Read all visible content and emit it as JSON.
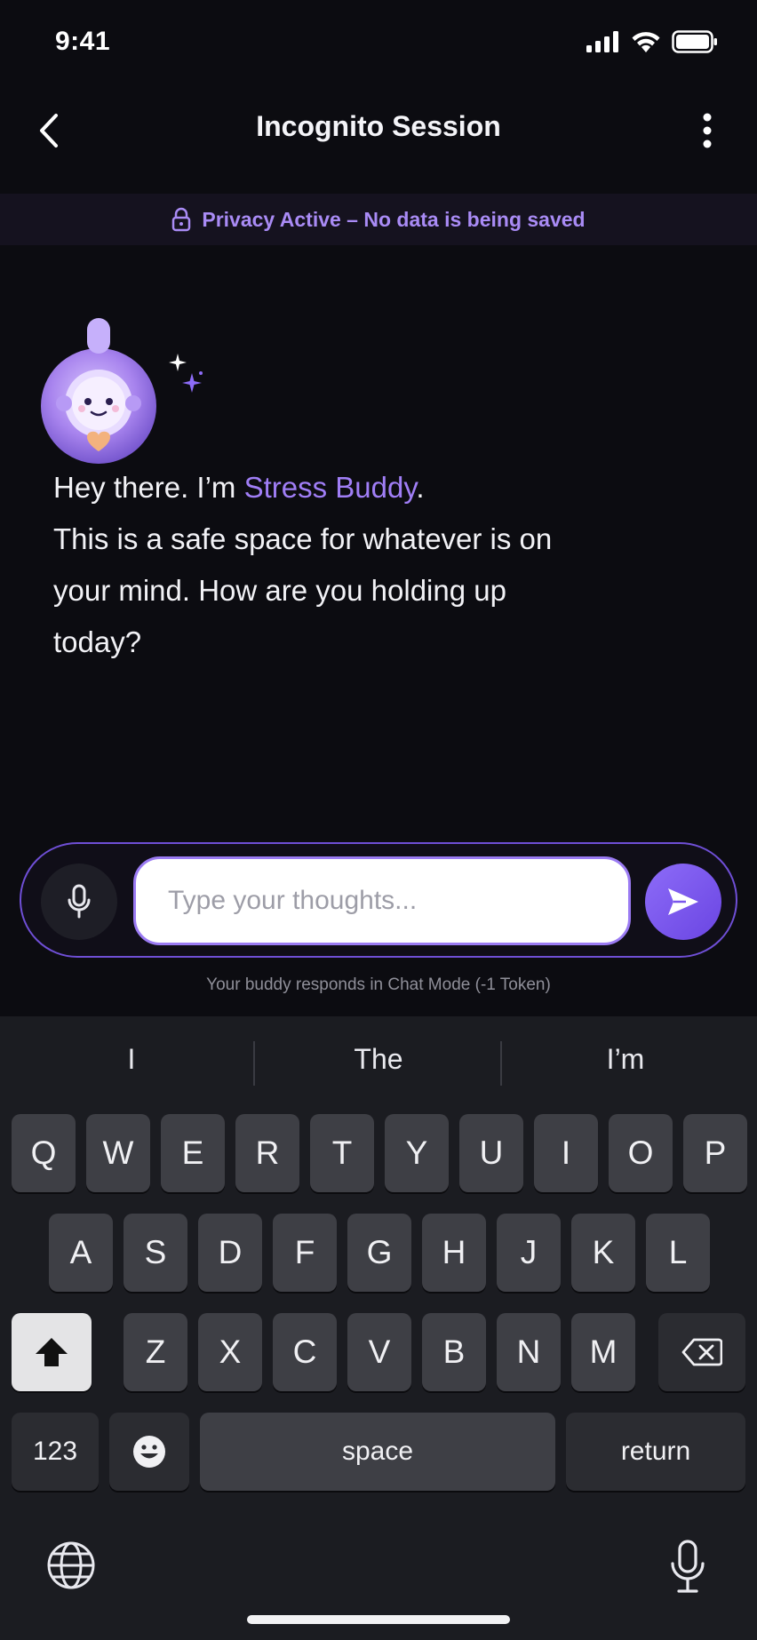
{
  "status_bar": {
    "time": "9:41"
  },
  "header": {
    "title": "Incognito Session"
  },
  "privacy_banner": {
    "text": "Privacy Active – No data is being saved"
  },
  "chat": {
    "greeting_prefix": "Hey there. I’m ",
    "buddy_name": "Stress Buddy",
    "greeting_suffix": ".",
    "message_body": "This is a safe space for whatever is on your mind. How are you holding up today?"
  },
  "composer": {
    "placeholder": "Type your thoughts...",
    "mode_note": "Your buddy responds in Chat Mode (-1 Token)"
  },
  "keyboard": {
    "suggestions": [
      "I",
      "The",
      "I’m"
    ],
    "row1": [
      "Q",
      "W",
      "E",
      "R",
      "T",
      "Y",
      "U",
      "I",
      "O",
      "P"
    ],
    "row2": [
      "A",
      "S",
      "D",
      "F",
      "G",
      "H",
      "J",
      "K",
      "L"
    ],
    "row3": [
      "Z",
      "X",
      "C",
      "V",
      "B",
      "N",
      "M"
    ],
    "numbers_label": "123",
    "space_label": "space",
    "return_label": "return"
  },
  "colors": {
    "accent": "#8d6cf8",
    "accent_text": "#a07ef6",
    "background": "#0c0c11",
    "keyboard_bg": "#1b1c21",
    "key_bg": "#3e3f45"
  },
  "icons": {
    "back": "chevron-left-icon",
    "more": "vertical-ellipsis-icon",
    "lock": "lock-icon",
    "mic": "microphone-icon",
    "send": "send-arrow-icon",
    "shift": "shift-arrow-icon",
    "delete": "backspace-icon",
    "emoji": "emoji-icon",
    "globe": "globe-icon",
    "dictation": "microphone-icon"
  }
}
